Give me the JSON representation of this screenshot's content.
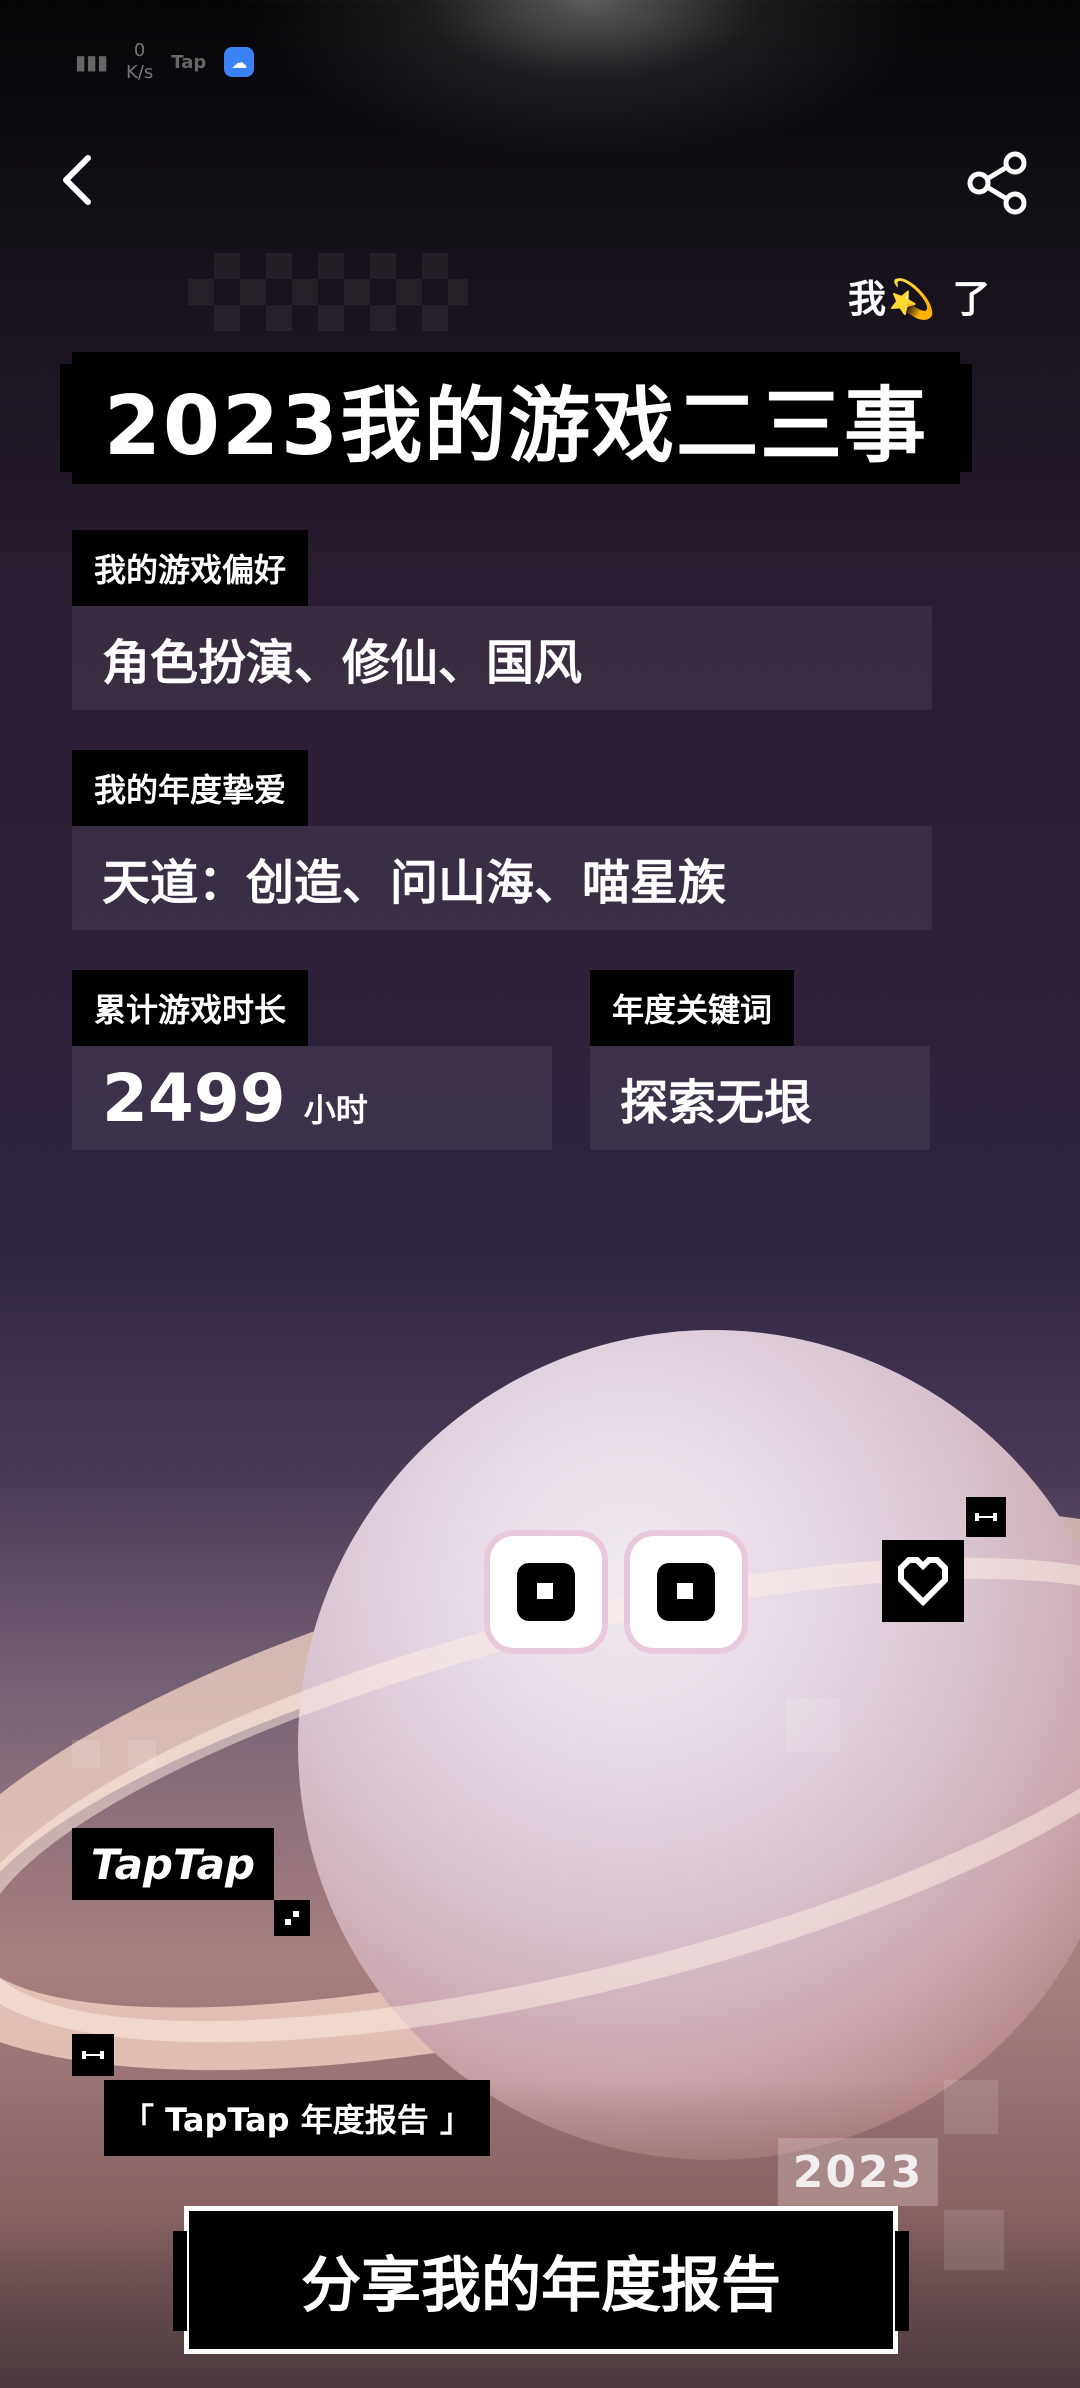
{
  "status_bar": {
    "speed_value": "0",
    "speed_unit": "K/s",
    "app_label": "Tap"
  },
  "header": {
    "wo_le_text": "我💫 了",
    "title": "2023我的游戏二三事"
  },
  "preference": {
    "label": "我的游戏偏好",
    "value": "角色扮演、修仙、国风"
  },
  "favorites": {
    "label": "我的年度挚爱",
    "value": "天道：创造、问山海、喵星族"
  },
  "playtime": {
    "label": "累计游戏时长",
    "value": "2499",
    "unit": "小时"
  },
  "keyword": {
    "label": "年度关键词",
    "value": "探索无垠"
  },
  "branding": {
    "logo": "TapTap",
    "report_tag": "「 TapTap 年度报告 」",
    "year": "2023"
  },
  "cta": {
    "share_label": "分享我的年度报告"
  },
  "icons": {
    "back": "back-arrow-icon",
    "share": "share-icon",
    "heart": "heart-icon"
  }
}
